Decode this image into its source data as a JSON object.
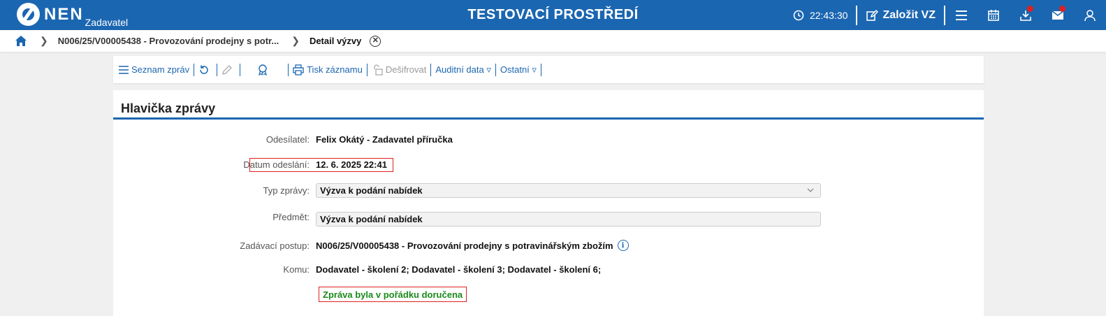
{
  "header": {
    "logo_text": "NEN",
    "logo_sub": "Zadavatel",
    "env_title": "TESTOVACÍ PROSTŘEDÍ",
    "time": "22:43:30",
    "create_label": "Založit VZ",
    "brand_color": "#1b66b1",
    "notification_color": "#e02020",
    "icons": [
      "clock-icon",
      "edit-icon",
      "menu-icon",
      "calendar-icon",
      "download-icon",
      "mail-icon",
      "user-icon"
    ]
  },
  "breadcrumb": {
    "items": [
      "N006/25/V00005438 - Provozování prodejny s potr...",
      "Detail výzvy"
    ]
  },
  "toolbar": {
    "list_label": "Seznam zpráv",
    "print_label": "Tisk záznamu",
    "decrypt_label": "Dešifrovat",
    "audit_label": "Auditní data ▿",
    "other_label": "Ostatní ▿"
  },
  "message": {
    "title": "Hlavička zprávy",
    "fields": {
      "sender": {
        "label": "Odesílatel:",
        "value": "Felix Okátý - Zadavatel příručka"
      },
      "sent_date": {
        "label": "Datum odeslání:",
        "value": "12. 6. 2025 22:41"
      },
      "type": {
        "label": "Typ zprávy:",
        "value": "Výzva k podání nabídek"
      },
      "subject": {
        "label": "Předmět:",
        "value": "Výzva k podání nabídek"
      },
      "procedure": {
        "label": "Zadávací postup:",
        "value": "N006/25/V00005438 - Provozování prodejny s potravinářským zbožím"
      },
      "recipients": {
        "label": "Komu:",
        "value": "Dodavatel - školení 2; Dodavatel - školení 3; Dodavatel - školení 6;"
      }
    },
    "status": "Zpráva byla v pořádku doručena",
    "status_color": "#1a8a1a",
    "highlight_color": "#dd2222"
  }
}
